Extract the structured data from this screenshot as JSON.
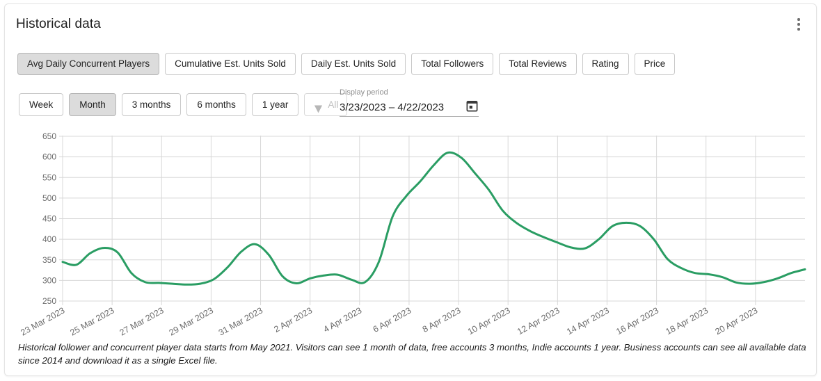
{
  "card": {
    "title": "Historical data",
    "menu_icon": "kebab-menu-icon"
  },
  "metric_tabs": [
    {
      "label": "Avg Daily Concurrent Players",
      "active": true
    },
    {
      "label": "Cumulative Est. Units Sold",
      "active": false
    },
    {
      "label": "Daily Est. Units Sold",
      "active": false
    },
    {
      "label": "Total Followers",
      "active": false
    },
    {
      "label": "Total Reviews",
      "active": false
    },
    {
      "label": "Rating",
      "active": false
    },
    {
      "label": "Price",
      "active": false
    }
  ],
  "period_tabs": [
    {
      "label": "Week",
      "active": false,
      "disabled": false
    },
    {
      "label": "Month",
      "active": true,
      "disabled": false
    },
    {
      "label": "3 months",
      "active": false,
      "disabled": false
    },
    {
      "label": "6 months",
      "active": false,
      "disabled": false
    },
    {
      "label": "1 year",
      "active": false,
      "disabled": false
    },
    {
      "label": "All",
      "active": false,
      "disabled": true,
      "icon": "gem-icon"
    }
  ],
  "display_period": {
    "label": "Display period",
    "value": "3/23/2023 – 4/22/2023",
    "icon": "calendar-icon"
  },
  "footnote": "Historical follower and concurrent player data starts from May 2021. Visitors can see 1 month of data, free accounts 3 months, Indie accounts 1 year. Business accounts can see all available data since 2014 and download it as a single Excel file.",
  "colors": {
    "line": "#2a9d63",
    "grid": "#d8d8d8",
    "axis_text": "#6b6b6b",
    "active_tab_bg": "#dcdcdc"
  },
  "chart_data": {
    "type": "line",
    "title": "Avg Daily Concurrent Players",
    "xlabel": "",
    "ylabel": "",
    "ylim": [
      250,
      650
    ],
    "ytick_values": [
      250,
      300,
      350,
      400,
      450,
      500,
      550,
      600,
      650
    ],
    "ytick_labels": [
      "250",
      "300",
      "350",
      "400",
      "450",
      "500",
      "550",
      "600",
      "650"
    ],
    "grid": true,
    "legend": false,
    "xtick_labels": [
      "23 Mar 2023",
      "25 Mar 2023",
      "27 Mar 2023",
      "29 Mar 2023",
      "31 Mar 2023",
      "2 Apr 2023",
      "4 Apr 2023",
      "6 Apr 2023",
      "8 Apr 2023",
      "10 Apr 2023",
      "12 Apr 2023",
      "14 Apr 2023",
      "16 Apr 2023",
      "18 Apr 2023",
      "20 Apr 2023"
    ],
    "x": [
      "23 Mar 2023",
      "24 Mar 2023",
      "25 Mar 2023",
      "26 Mar 2023",
      "27 Mar 2023",
      "28 Mar 2023",
      "29 Mar 2023",
      "30 Mar 2023",
      "31 Mar 2023",
      "1 Apr 2023",
      "2 Apr 2023",
      "3 Apr 2023",
      "4 Apr 2023",
      "5 Apr 2023",
      "6 Apr 2023",
      "7 Apr 2023",
      "8 Apr 2023",
      "9 Apr 2023",
      "10 Apr 2023",
      "11 Apr 2023",
      "12 Apr 2023",
      "13 Apr 2023",
      "14 Apr 2023",
      "15 Apr 2023",
      "16 Apr 2023",
      "17 Apr 2023",
      "18 Apr 2023",
      "19 Apr 2023",
      "20 Apr 2023",
      "21 Apr 2023",
      "22 Apr 2023"
    ],
    "series": [
      {
        "name": "Avg Daily Concurrent Players",
        "values": [
          345,
          338,
          366,
          379,
          368,
          318,
          296,
          294,
          292,
          290,
          292,
          303,
          332,
          370,
          388,
          362,
          310,
          293,
          305,
          312,
          314,
          302,
          296,
          345,
          455,
          505,
          540,
          580,
          610,
          598,
          560,
          520,
          470,
          440,
          420,
          405,
          392,
          380,
          378,
          400,
          432,
          440,
          432,
          400,
          352,
          330,
          318,
          315,
          308,
          295,
          292,
          296,
          305,
          318,
          327
        ]
      }
    ]
  }
}
